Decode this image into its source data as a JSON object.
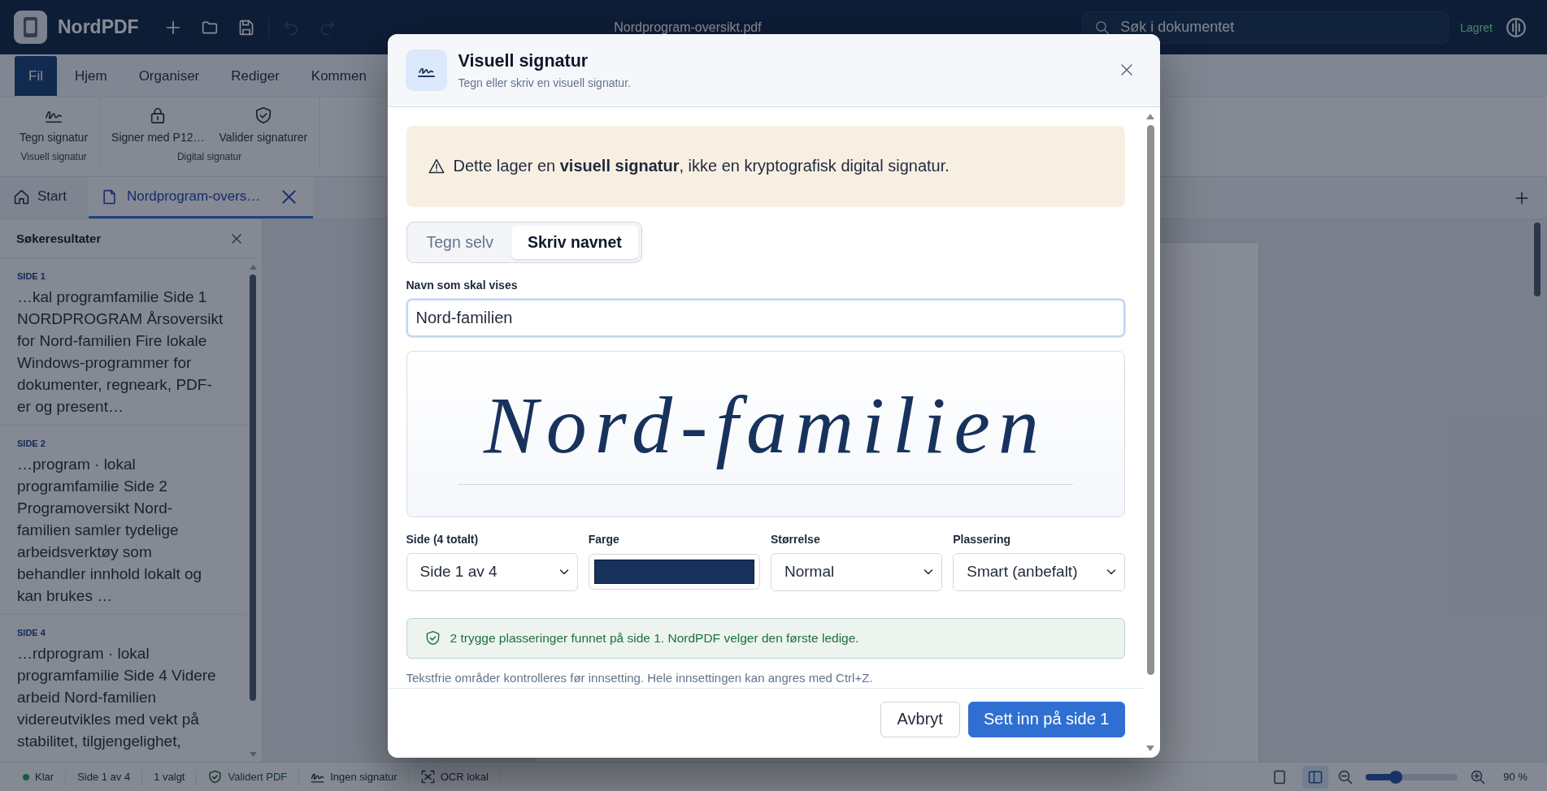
{
  "app_bar": {
    "app_name": "NordPDF",
    "toolbar": [
      {
        "disabled": false
      },
      {
        "disabled": false
      },
      {
        "disabled": false
      },
      {
        "disabled": true
      },
      {
        "disabled": true
      }
    ],
    "document_title": "Nordprogram-oversikt.pdf",
    "search": {
      "placeholder": "Søk i dokumentet"
    },
    "save_status": "Lagret"
  },
  "ribbon": {
    "tabs": [
      {
        "label": "Fil",
        "selected": true
      },
      {
        "label": "Hjem",
        "selected": false
      },
      {
        "label": "Organiser",
        "selected": false
      },
      {
        "label": "Rediger",
        "selected": false
      },
      {
        "label": "Kommen",
        "selected": false
      }
    ],
    "groups": [
      {
        "label": "Visuell signatur",
        "buttons": [
          "Tegn signatur"
        ]
      },
      {
        "label": "Digital signatur",
        "buttons": [
          "Signer med P12…",
          "Valider signaturer"
        ]
      }
    ]
  },
  "document_tabs": [
    {
      "kind": "home",
      "label": "Start",
      "selected": false,
      "closable": false
    },
    {
      "kind": "document",
      "label": "Nordprogram-overs…",
      "selected": true,
      "closable": true
    }
  ],
  "search_results": {
    "title": "Søkeresultater",
    "results": [
      {
        "page": "SIDE 1",
        "excerpt": "…kal programfamilie Side 1 NORDPROGRAM Årsoversikt for Nord-familien Fire lokale Windows-programmer for dokumenter, regneark, PDF-er og present…"
      },
      {
        "page": "SIDE 2",
        "excerpt": "…program · lokal programfamilie Side 2 Programoversikt Nord-familien samler tydelige arbeidsverktøy som behandler innhold lokalt og kan brukes …"
      },
      {
        "page": "SIDE 4",
        "excerpt": "…rdprogram · lokal programfamilie Side 4 Videre arbeid Nord-familien videreutvikles med vekt på stabilitet, tilgjengelighet,"
      }
    ]
  },
  "status_bar": {
    "items": [
      {
        "kind": "ready",
        "label": "Klar"
      },
      {
        "kind": "text",
        "label": "Side 1 av 4"
      },
      {
        "kind": "text",
        "label": "1 valgt"
      },
      {
        "kind": "valid",
        "label": "Validert PDF"
      },
      {
        "kind": "signature",
        "label": "Ingen signatur"
      },
      {
        "kind": "ocr",
        "label": "OCR lokal"
      }
    ],
    "view_modes": [
      {
        "selected": false
      },
      {
        "selected": true
      }
    ],
    "zoom": {
      "level": 0.32,
      "reading": "90 %"
    }
  },
  "dialog": {
    "title": "Visuell signatur",
    "subtitle": "Tegn eller skriv en visuell signatur.",
    "notice": "Dette lager en **visuell signatur**, ikke en kryptografisk digital signatur.",
    "modes": [
      {
        "label": "Tegn selv",
        "selected": false
      },
      {
        "label": "Skriv navnet",
        "selected": true
      }
    ],
    "name_field": {
      "label": "Navn som skal vises",
      "value": "Nord-familien",
      "focused": true
    },
    "preview": {
      "text": "Nord-familien"
    },
    "options": [
      {
        "kind": "select",
        "label": "Side (4 totalt)",
        "value": "Side 1 av 4"
      },
      {
        "kind": "color",
        "label": "Farge",
        "color": "#17325c"
      },
      {
        "kind": "select",
        "label": "Størrelse",
        "value": "Normal"
      },
      {
        "kind": "select",
        "label": "Plassering",
        "value": "Smart (anbefalt)"
      }
    ],
    "status": "2 trygge plasseringer funnet på side 1. NordPDF velger den første ledige.",
    "hint": "Tekstfrie områder kontrolleres før innsetting. Hele innsettingen kan angres med Ctrl+Z.",
    "buttons": [
      {
        "kind": "secondary",
        "label": "Avbryt"
      },
      {
        "kind": "primary",
        "label": "Sett inn på side 1"
      }
    ]
  }
}
